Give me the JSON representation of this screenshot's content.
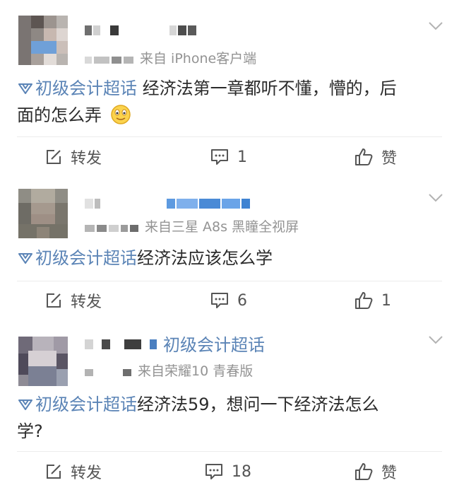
{
  "posts": [
    {
      "source": "来自 iPhone客户端",
      "topic": "初级会计超话",
      "text_line1": " 经济法第一章都听不懂，懵的，后",
      "text_line2": "面的怎么弄",
      "emoji": "smiling-face-emoji",
      "actions": {
        "repost": "转发",
        "comment": "1",
        "like": "赞"
      }
    },
    {
      "source": "来自三星 A8s 黑瞳全视屏",
      "topic": "初级会计超话",
      "text_line1": "经济法应该怎么学",
      "actions": {
        "repost": "转发",
        "comment": "6",
        "like": "1"
      }
    },
    {
      "name_topic": "初级会计超话",
      "source": "来自荣耀10 青春版",
      "topic": "初级会计超话",
      "text_line1": "经济法59，想问一下经济法怎么",
      "text_line2": "学?",
      "actions": {
        "repost": "转发",
        "comment": "18",
        "like": "赞"
      }
    }
  ],
  "icons": {
    "topic": "super-topic-diamond-icon",
    "repost": "repost-edit-icon",
    "comment": "comment-bubble-icon",
    "like": "thumbs-up-icon",
    "menu": "chevron-down-icon"
  },
  "colors": {
    "link": "#5b84b6",
    "meta": "#939393",
    "text": "#2b2b2b"
  }
}
